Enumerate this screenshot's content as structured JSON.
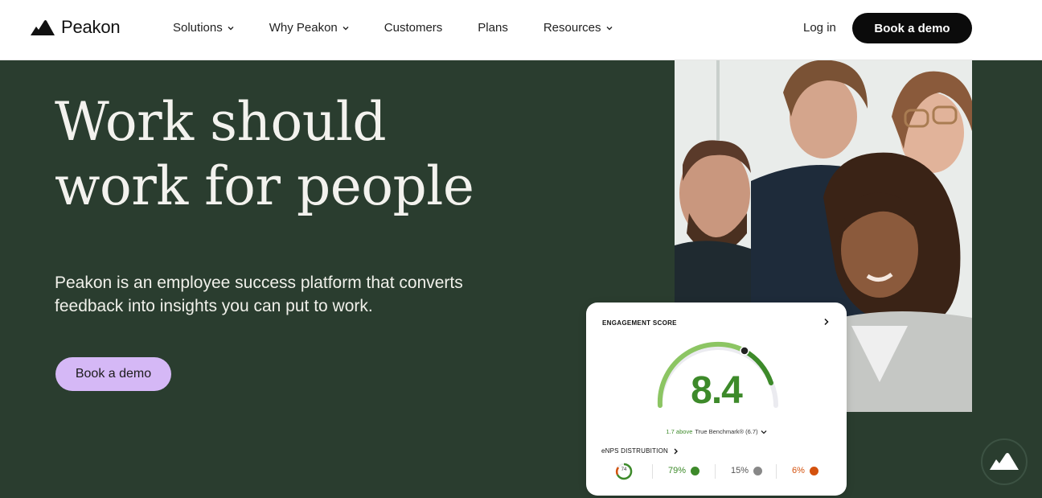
{
  "nav": {
    "brand": "Peakon",
    "links": [
      {
        "label": "Solutions",
        "has_dropdown": true
      },
      {
        "label": "Why Peakon",
        "has_dropdown": true
      },
      {
        "label": "Customers",
        "has_dropdown": false
      },
      {
        "label": "Plans",
        "has_dropdown": false
      },
      {
        "label": "Resources",
        "has_dropdown": true
      }
    ],
    "login": "Log in",
    "cta": "Book a demo"
  },
  "hero": {
    "headline_line1": "Work should",
    "headline_line2": "work for people",
    "subtext_line1": "Peakon is an employee success platform that converts",
    "subtext_line2": "feedback into insights you can put to work.",
    "cta": "Book a demo"
  },
  "card": {
    "title": "ENGAGEMENT SCORE",
    "score": "8.4",
    "benchmark_above": "1.7 above",
    "benchmark_text": "True Benchmark® (6.7)",
    "enps_label": "eNPS DISTRUBITION",
    "enps_value": "74",
    "promoters": "79%",
    "passives": "15%",
    "detractors": "6%"
  },
  "colors": {
    "hero_bg": "#2a3d2f",
    "accent_green": "#3d8a2a",
    "cta_purple": "#d5b8f6",
    "detractor": "#d4520e"
  },
  "icons": {
    "logo": "peakon-mountain-logo",
    "chevron": "chevron-down-icon",
    "card_arrow": "chevron-right-icon",
    "float": "peakon-mountain-icon"
  }
}
